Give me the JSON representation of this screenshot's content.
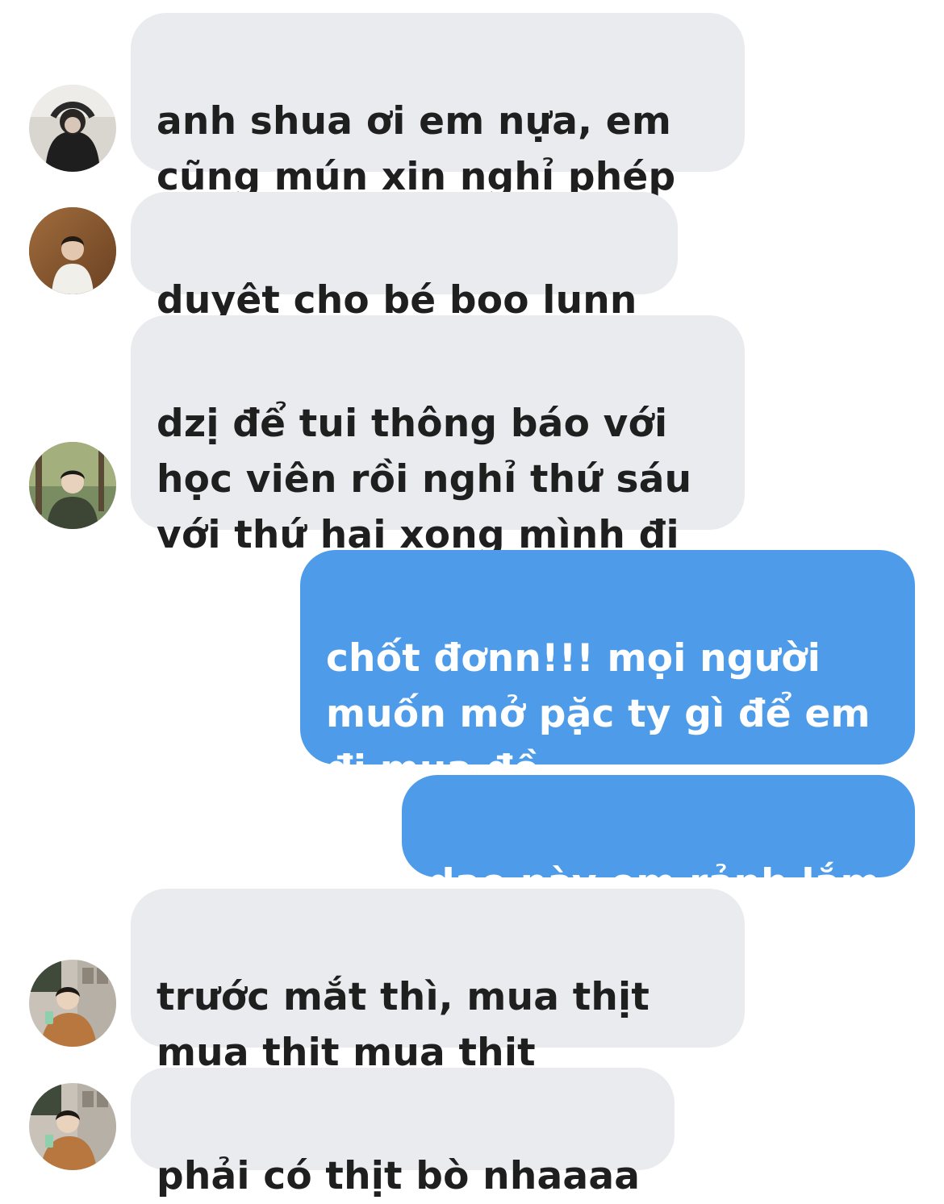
{
  "conversation": {
    "messages": [
      {
        "direction": "incoming",
        "avatar": "avatar-photo-1",
        "text": "anh shua ơi em nựa, em\ncũng mún xin nghỉ phép"
      },
      {
        "direction": "incoming",
        "avatar": "avatar-photo-2",
        "text": "duyệt cho bé boo lunn"
      },
      {
        "direction": "incoming",
        "avatar": "avatar-photo-3",
        "text": "dzị để tui thông báo với\nhọc viên rồi nghỉ thứ sáu\nvới thứ hai xong mình đi"
      },
      {
        "direction": "outgoing",
        "text": "chốt đơnn!!! mọi người\nmuốn mở pặc ty gì để em\nđi mua đồ"
      },
      {
        "direction": "outgoing",
        "text": "dạo này em rảnh lắm"
      },
      {
        "direction": "incoming",
        "avatar": "avatar-photo-4",
        "text": "trước mắt thì, mua thịt\nmua thịt mua thịt"
      },
      {
        "direction": "incoming",
        "avatar": "avatar-photo-4",
        "text": "phải có thịt bò nhaaaa"
      }
    ]
  },
  "colors": {
    "incoming_bubble": "#e9ebef",
    "incoming_text": "#1f1f1f",
    "outgoing_bubble": "#4e9ce9",
    "outgoing_text": "#ffffff",
    "background": "#ffffff"
  }
}
